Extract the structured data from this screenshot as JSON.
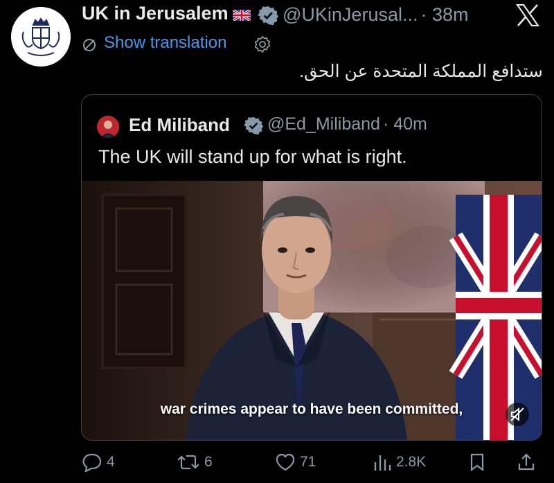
{
  "tweet": {
    "display_name": "UK in Jerusalem",
    "handle": "@UKinJerusal...",
    "timestamp": "· 38m",
    "show_translation": "Show translation",
    "text": "ستدافع المملكة المتحدة عن الحق."
  },
  "quoted_tweet": {
    "display_name": "Ed Miliband",
    "handle": "@Ed_Miliband",
    "timestamp": "· 40m",
    "text": "The UK will stand up for what is right.",
    "video_caption": "war crimes appear to have been committed,"
  },
  "actions": {
    "replies": "4",
    "reposts": "6",
    "likes": "71",
    "views": "2.8K"
  },
  "colors": {
    "background": "#000000",
    "link": "#4a99e9",
    "muted": "#8b98a5",
    "verified": "#829aab"
  },
  "icons": [
    "x-logo-icon",
    "verified-badge-icon",
    "translate-icon",
    "gear-icon",
    "mute-icon",
    "reply-icon",
    "repost-icon",
    "like-icon",
    "views-icon",
    "bookmark-icon",
    "share-icon"
  ]
}
